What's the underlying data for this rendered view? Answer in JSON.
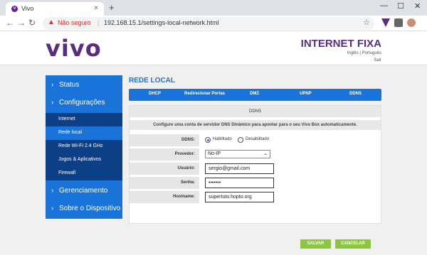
{
  "browser": {
    "tab_title": "Vivo",
    "tab_favicon": "v",
    "tab_close": "×",
    "new_tab": "+",
    "not_secure": "Não seguro",
    "separator": "|",
    "url": "192.168.15.1/settings-local-network.html",
    "icons": [
      "back-icon",
      "forward-icon",
      "reload-icon",
      "warning-icon",
      "star-icon",
      "minimize-icon",
      "maximize-icon",
      "close-icon"
    ]
  },
  "header": {
    "logo": "vivo",
    "brand_title": "INTERNET FIXA",
    "language": "Inglês | Português",
    "logout": "Sair"
  },
  "sidebar": {
    "main_items": [
      {
        "label": "Status"
      },
      {
        "label": "Configurações"
      },
      {
        "label": "Gerenciamento"
      },
      {
        "label": "Sobre o Dispositivo"
      }
    ],
    "sub_items": [
      {
        "label": "Internet"
      },
      {
        "label": "Rede local",
        "active": true
      },
      {
        "label": "Rede Wi-Fi 2.4 GHz"
      },
      {
        "label": "Jogos & Aplicativos"
      },
      {
        "label": "Firewall"
      }
    ],
    "chevron": "›"
  },
  "content": {
    "section_title": "REDE LOCAL",
    "tabs": [
      "DHCP",
      "Redirecionar Portas",
      "DMZ",
      "UPNP",
      "DDNS"
    ],
    "panel_title": "DDNS",
    "panel_description": "Configure uma conta de servidor DNS Dinâmico para apontar para o seu Vivo Box automaticamente.",
    "form": {
      "ddns_label": "DDNS:",
      "ddns_enabled_label": "Habilitado",
      "ddns_disabled_label": "Desabilitado",
      "ddns_value": "enabled",
      "provider_label": "Provedor:",
      "provider_value": "No-IP",
      "user_label": "Usuário:",
      "user_value": "sergio@gmail.com",
      "password_label": "Senha:",
      "password_value": "•••••••",
      "hostname_label": "Hostname:",
      "hostname_value": "supertuto.hopto.org"
    },
    "save_label": "SALVAR",
    "cancel_label": "CANCELAR"
  },
  "colors": {
    "brand_purple": "#5a2d82",
    "primary_blue": "#1a73d8",
    "dark_blue": "#0d3f86",
    "button_green": "#8cc63f"
  }
}
